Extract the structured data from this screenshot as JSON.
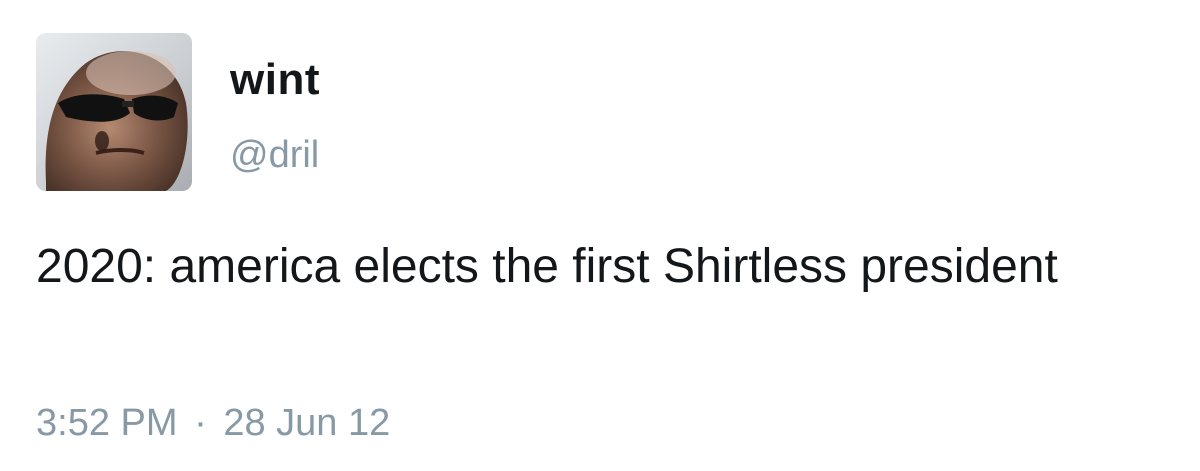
{
  "tweet": {
    "display_name": "wint",
    "handle": "@dril",
    "text": "2020: america elects the first Shirtless president",
    "time": "3:52 PM",
    "separator": "·",
    "date": "28 Jun 12"
  },
  "colors": {
    "text": "#14171a",
    "secondary": "#8899a6",
    "background": "#ffffff"
  }
}
